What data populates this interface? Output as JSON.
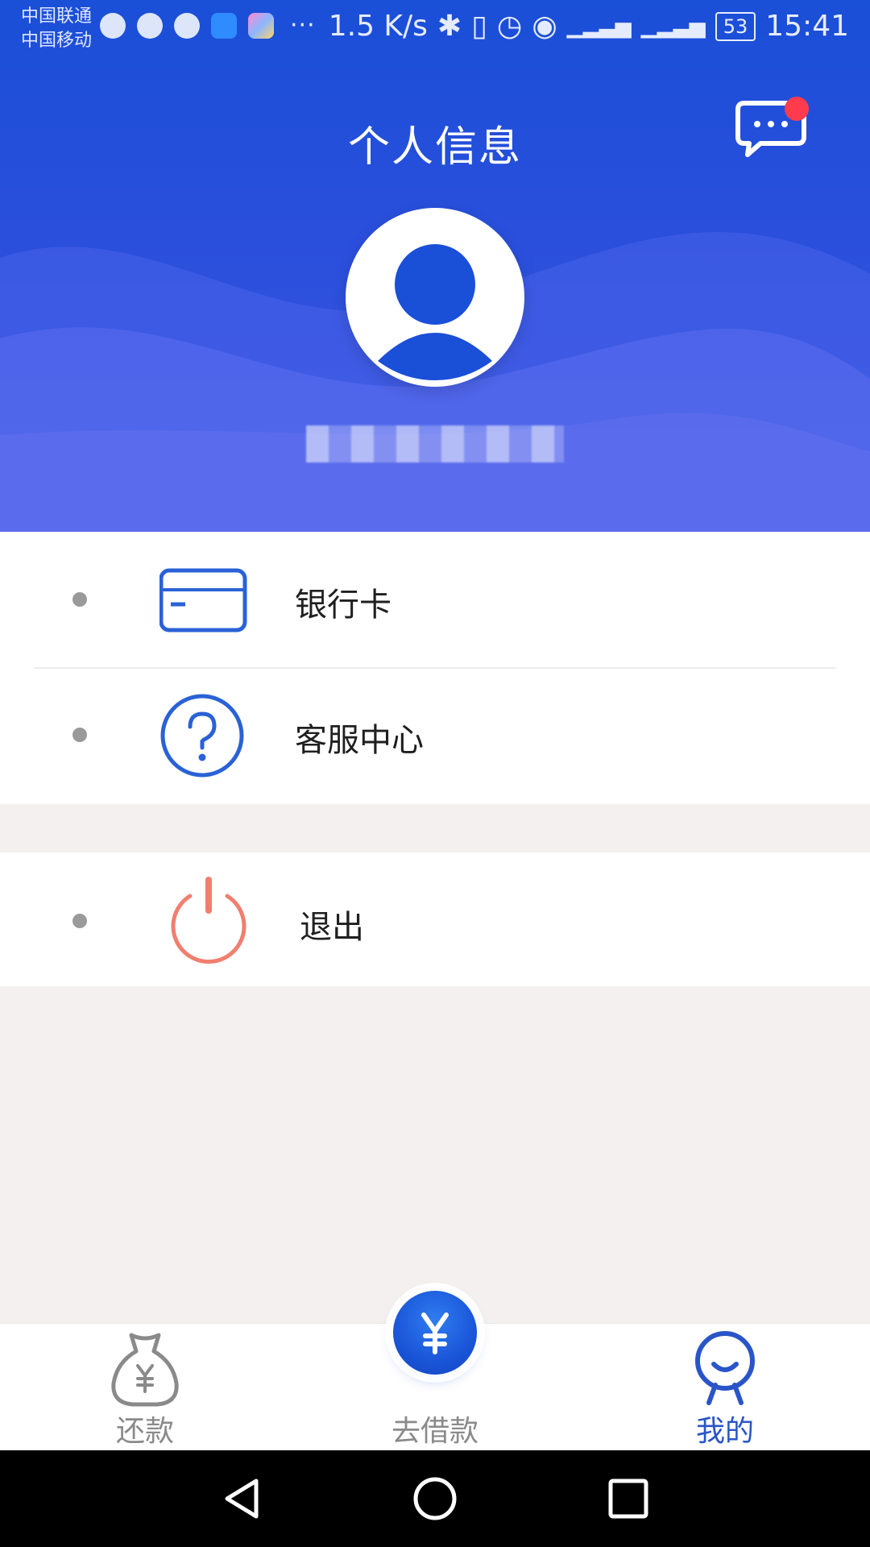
{
  "status_bar": {
    "carrier_1": "中国联通",
    "carrier_2": "中国移动",
    "net_speed": "1.5 K/s",
    "battery": "53",
    "time": "15:41",
    "more": "···"
  },
  "header": {
    "title": "个人信息",
    "username": ""
  },
  "menu": {
    "bank_card": "银行卡",
    "customer_service": "客服中心",
    "logout": "退出"
  },
  "tabbar": {
    "repay": "还款",
    "borrow": "去借款",
    "mine": "我的"
  },
  "colors": {
    "brand_blue": "#1a4fd8",
    "icon_blue": "#2a62d6",
    "logout_red": "#f07f6f",
    "active_tab": "#2a55c8",
    "inactive_tab": "#8a8a8a",
    "badge_red": "#ff3b4d"
  },
  "icons": {
    "message": "message-bubble-icon",
    "bank_card": "credit-card-icon",
    "customer_service": "question-circle-icon",
    "logout": "power-icon",
    "repay": "money-bag-yen-icon",
    "borrow": "yen-icon",
    "mine": "person-smile-icon"
  }
}
